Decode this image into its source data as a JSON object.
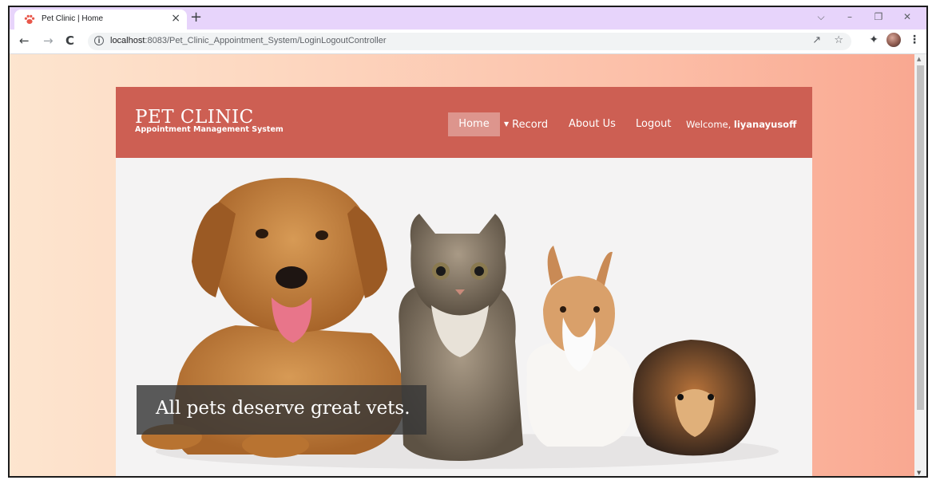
{
  "browser": {
    "tab_title": "Pet Clinic | Home",
    "tab_close": "×",
    "new_tab": "+",
    "url_host": "localhost",
    "url_path": ":8083/Pet_Clinic_Appointment_System/LoginLogoutController",
    "window_controls": [
      "⌵",
      "–",
      "❐",
      "✕"
    ]
  },
  "site": {
    "brand_title": "PET CLINIC",
    "brand_subtitle": "Appointment Management System",
    "nav": {
      "home": "Home",
      "record": "Record",
      "about": "About Us",
      "logout": "Logout",
      "welcome_prefix": "Welcome, ",
      "username": "liyanayusoff"
    },
    "hero_caption": "All pets deserve great vets."
  },
  "colors": {
    "header_bg": "#cd5f53",
    "nav_active_bg": "#dd958d",
    "tabstrip_bg": "#e7d4fb"
  },
  "icons": {
    "favicon": "paw-icon",
    "back": "back-arrow-icon",
    "forward": "forward-arrow-icon",
    "reload": "reload-icon",
    "info": "info-icon",
    "share": "share-icon",
    "star": "bookmark-star-icon",
    "extensions": "puzzle-icon",
    "profile": "avatar",
    "menu": "kebab-menu-icon"
  }
}
